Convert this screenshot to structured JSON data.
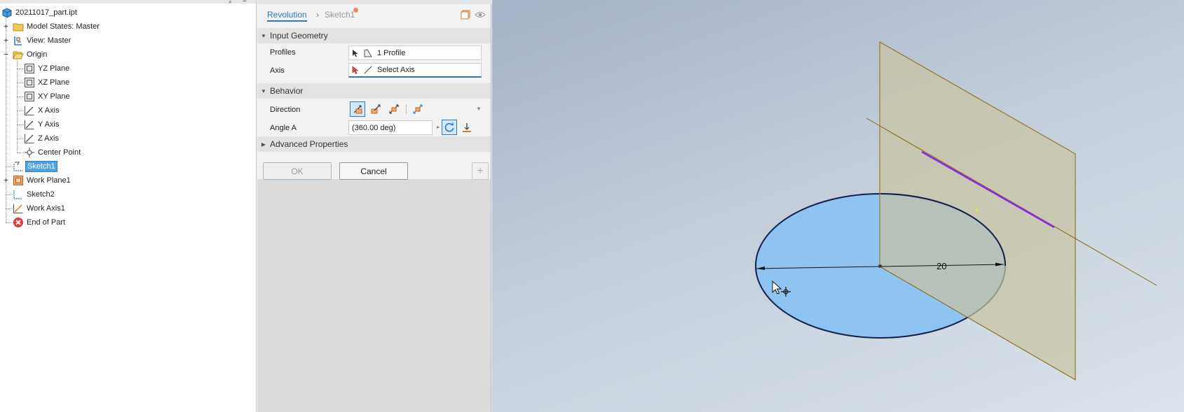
{
  "browser": {
    "file_name": "20211017_part.ipt",
    "items": [
      {
        "label": "Model States: Master"
      },
      {
        "label": "View: Master"
      },
      {
        "label": "Origin"
      },
      {
        "label": "YZ Plane"
      },
      {
        "label": "XZ Plane"
      },
      {
        "label": "XY Plane"
      },
      {
        "label": "X Axis"
      },
      {
        "label": "Y Axis"
      },
      {
        "label": "Z Axis"
      },
      {
        "label": "Center Point"
      },
      {
        "label": "Sketch1"
      },
      {
        "label": "Work Plane1"
      },
      {
        "label": "Sketch2"
      },
      {
        "label": "Work Axis1"
      },
      {
        "label": "End of Part"
      }
    ]
  },
  "panel": {
    "tab_label": "Revolution",
    "breadcrumb_sketch": "Sketch1",
    "input_geometry_title": "Input Geometry",
    "profiles_label": "Profiles",
    "profiles_value": "1 Profile",
    "axis_label": "Axis",
    "axis_value": "Select Axis",
    "behavior_title": "Behavior",
    "direction_label": "Direction",
    "angle_label": "Angle A",
    "angle_value": "(360.00 deg)",
    "advanced_title": "Advanced Properties",
    "ok_label": "OK",
    "cancel_label": "Cancel"
  },
  "viewport": {
    "dimension_value": "20"
  },
  "colors": {
    "accent": "#2a7ac4",
    "profile_fill": "#8ec3f2",
    "work_plane_fill": "#c7c3a4",
    "work_axis": "#8e6a0a",
    "sketch_line": "#8a2be2",
    "end_of_part": "#e53935"
  }
}
